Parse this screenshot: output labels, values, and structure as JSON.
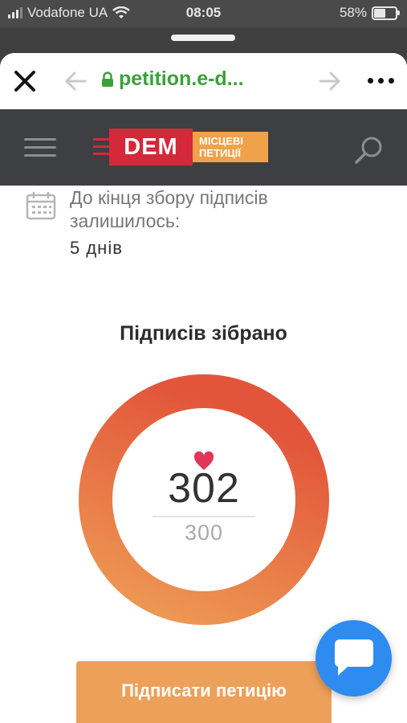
{
  "status_bar": {
    "carrier": "Vodafone UA",
    "time": "08:05",
    "battery": "58%",
    "battery_level": 0.58
  },
  "browser": {
    "url": "petition.e-d..."
  },
  "site": {
    "logo_text": "DEM",
    "logo_subtitle_line1": "МІСЦЕВІ",
    "logo_subtitle_line2": "ПЕТИЦІЇ"
  },
  "deadline": {
    "label": "До кінця збору підписів залишилось:",
    "value": "5 днів"
  },
  "signatures": {
    "title": "Підписів зібрано",
    "count": "302",
    "goal": "300",
    "progress": 1.0
  },
  "actions": {
    "sign_label": "Підписати петицію"
  },
  "colors": {
    "ring_start": "#ee9c55",
    "ring_end": "#e2553a",
    "header": "#3d3f42",
    "url_green": "#3aa13a",
    "chat": "#2e8bf0"
  }
}
